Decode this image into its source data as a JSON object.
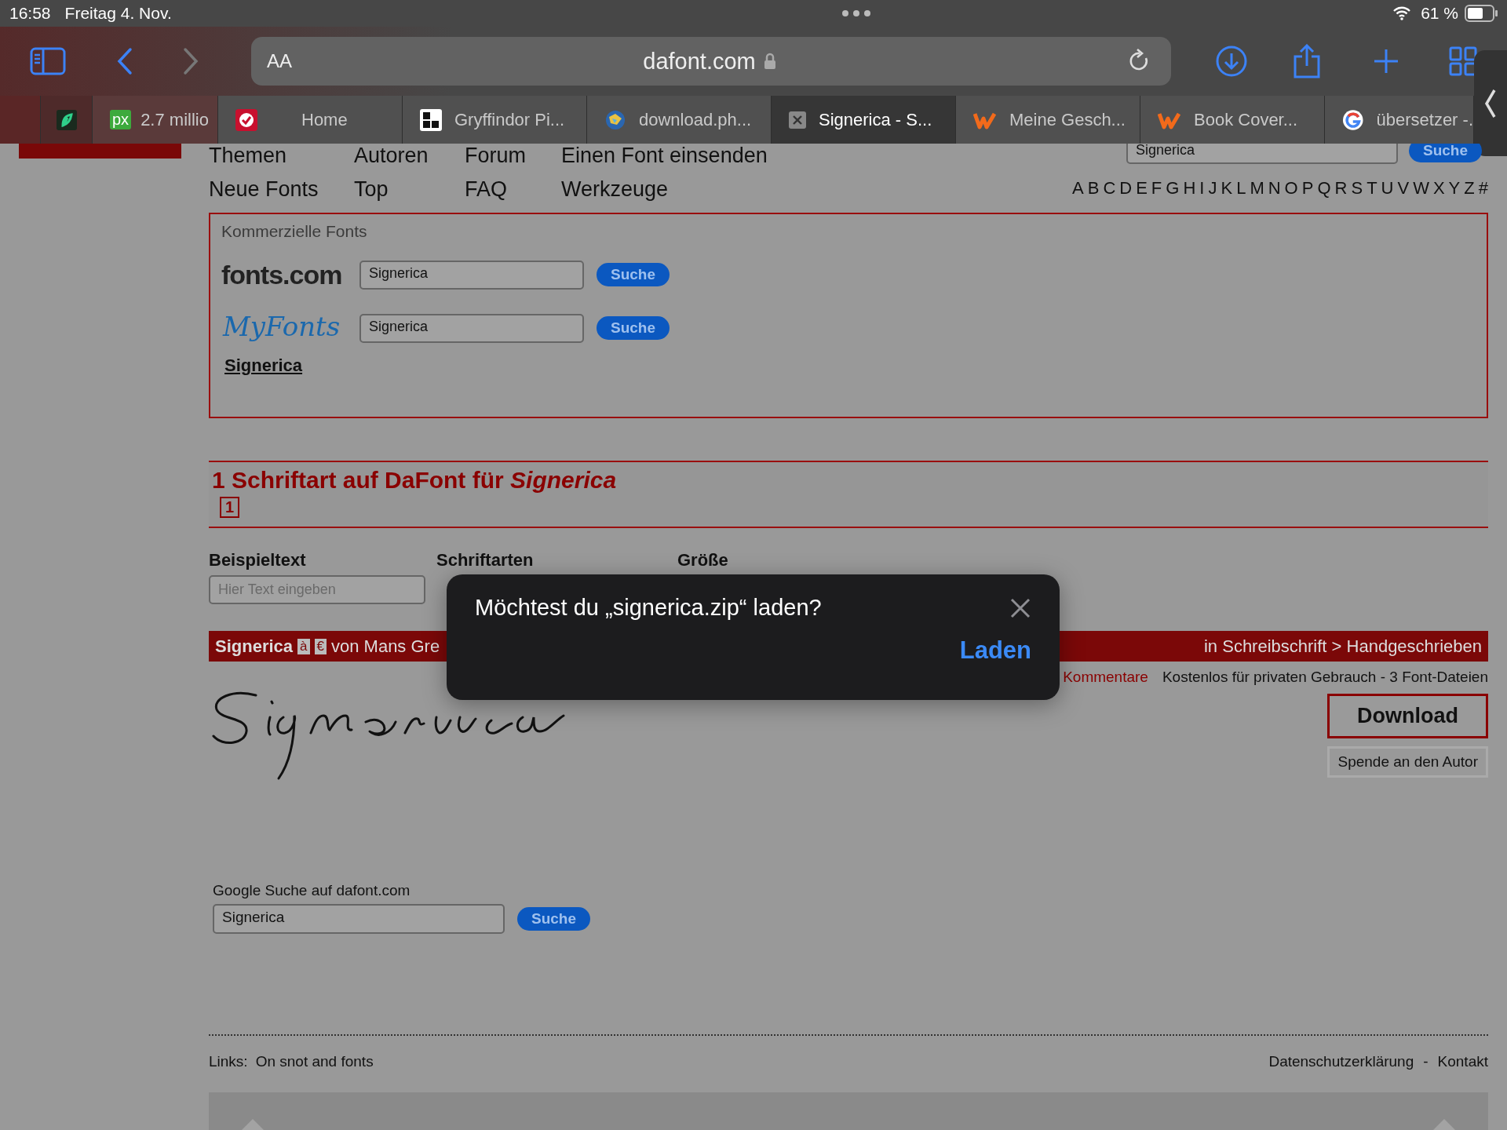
{
  "status_bar": {
    "time": "16:58",
    "date": "Freitag 4. Nov.",
    "battery": "61 %"
  },
  "toolbar": {
    "text_size": "AA",
    "url": "dafont.com"
  },
  "tabs": [
    {
      "kind": "blank",
      "selected": false
    },
    {
      "kind": "leaf",
      "selected": false
    },
    {
      "kind": "px",
      "badge": "px",
      "title": "2.7 millio",
      "selected": false
    },
    {
      "kind": "shield",
      "title": "Home",
      "selected": false
    },
    {
      "kind": "square",
      "title": "Gryffindor Pi...",
      "selected": false
    },
    {
      "kind": "globe",
      "title": "download.ph...",
      "selected": false
    },
    {
      "kind": "close",
      "title": "Signerica - S...",
      "selected": true
    },
    {
      "kind": "w",
      "title": "Meine Gesch...",
      "selected": false
    },
    {
      "kind": "w",
      "title": "Book Cover...",
      "selected": false
    },
    {
      "kind": "g",
      "title": "übersetzer -.",
      "selected": false
    }
  ],
  "nav": [
    [
      "Themen",
      "Autoren",
      "Forum",
      "Einen Font einsenden"
    ],
    [
      "Neue Fonts",
      "Top",
      "FAQ",
      "Werkzeuge"
    ]
  ],
  "top_search": {
    "value": "Signerica",
    "button": "Suche"
  },
  "alphabet": [
    "A",
    "B",
    "C",
    "D",
    "E",
    "F",
    "G",
    "H",
    "I",
    "J",
    "K",
    "L",
    "M",
    "N",
    "O",
    "P",
    "Q",
    "R",
    "S",
    "T",
    "U",
    "V",
    "W",
    "X",
    "Y",
    "Z",
    "#"
  ],
  "commercial": {
    "title": "Kommerzielle Fonts",
    "rows": [
      {
        "kind": "fontscom",
        "logo": "fonts.com",
        "value": "Signerica",
        "button": "Suche"
      },
      {
        "kind": "myfonts",
        "logo": "MyFonts",
        "value": "Signerica",
        "button": "Suche"
      }
    ],
    "link": "Signerica"
  },
  "results": {
    "title": "1 Schriftart auf DaFont für *Signerica*",
    "page": "1"
  },
  "controls": [
    {
      "label": "Beispieltext",
      "placeholder": "Hier Text eingeben"
    },
    {
      "label": "Schriftarten"
    },
    {
      "label": "Größe"
    }
  ],
  "font": {
    "name": "Signerica",
    "badges": [
      "à",
      "€"
    ],
    "author": "von Mans Gre",
    "category": "in Schreibschrift > Handgeschrieben",
    "comments": "Kommentare",
    "license": "Kostenlos für privaten Gebrauch - 3 Font-Dateien",
    "download": "Download",
    "donate": "Spende an den Autor"
  },
  "google": {
    "label": "Google Suche auf dafont.com",
    "value": "Signerica",
    "button": "Suche"
  },
  "footer": {
    "links_label": "Links:",
    "link": "On snot and fonts",
    "privacy": "Datenschutzerklärung",
    "separator": "-",
    "contact": "Kontakt"
  },
  "dialog": {
    "message": "Möchtest du „signerica.zip“ laden?",
    "action": "Laden"
  }
}
